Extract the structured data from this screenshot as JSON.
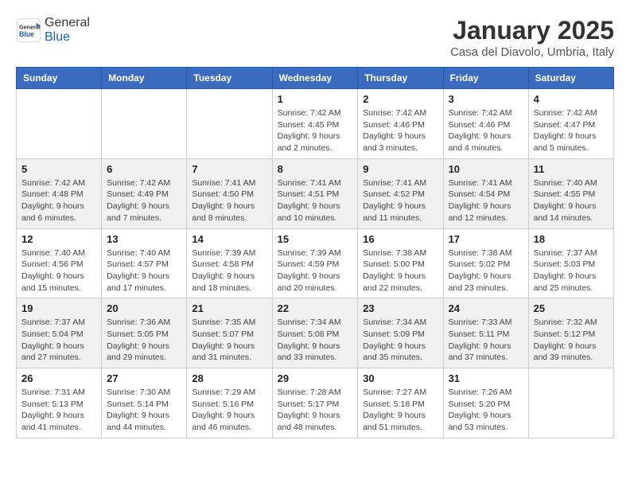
{
  "header": {
    "logo_general": "General",
    "logo_blue": "Blue",
    "title": "January 2025",
    "subtitle": "Casa del Diavolo, Umbria, Italy"
  },
  "weekdays": [
    "Sunday",
    "Monday",
    "Tuesday",
    "Wednesday",
    "Thursday",
    "Friday",
    "Saturday"
  ],
  "weeks": [
    [
      {
        "day": "",
        "info": ""
      },
      {
        "day": "",
        "info": ""
      },
      {
        "day": "",
        "info": ""
      },
      {
        "day": "1",
        "info": "Sunrise: 7:42 AM\nSunset: 4:45 PM\nDaylight: 9 hours and 2 minutes."
      },
      {
        "day": "2",
        "info": "Sunrise: 7:42 AM\nSunset: 4:46 PM\nDaylight: 9 hours and 3 minutes."
      },
      {
        "day": "3",
        "info": "Sunrise: 7:42 AM\nSunset: 4:46 PM\nDaylight: 9 hours and 4 minutes."
      },
      {
        "day": "4",
        "info": "Sunrise: 7:42 AM\nSunset: 4:47 PM\nDaylight: 9 hours and 5 minutes."
      }
    ],
    [
      {
        "day": "5",
        "info": "Sunrise: 7:42 AM\nSunset: 4:48 PM\nDaylight: 9 hours and 6 minutes."
      },
      {
        "day": "6",
        "info": "Sunrise: 7:42 AM\nSunset: 4:49 PM\nDaylight: 9 hours and 7 minutes."
      },
      {
        "day": "7",
        "info": "Sunrise: 7:41 AM\nSunset: 4:50 PM\nDaylight: 9 hours and 8 minutes."
      },
      {
        "day": "8",
        "info": "Sunrise: 7:41 AM\nSunset: 4:51 PM\nDaylight: 9 hours and 10 minutes."
      },
      {
        "day": "9",
        "info": "Sunrise: 7:41 AM\nSunset: 4:52 PM\nDaylight: 9 hours and 11 minutes."
      },
      {
        "day": "10",
        "info": "Sunrise: 7:41 AM\nSunset: 4:54 PM\nDaylight: 9 hours and 12 minutes."
      },
      {
        "day": "11",
        "info": "Sunrise: 7:40 AM\nSunset: 4:55 PM\nDaylight: 9 hours and 14 minutes."
      }
    ],
    [
      {
        "day": "12",
        "info": "Sunrise: 7:40 AM\nSunset: 4:56 PM\nDaylight: 9 hours and 15 minutes."
      },
      {
        "day": "13",
        "info": "Sunrise: 7:40 AM\nSunset: 4:57 PM\nDaylight: 9 hours and 17 minutes."
      },
      {
        "day": "14",
        "info": "Sunrise: 7:39 AM\nSunset: 4:58 PM\nDaylight: 9 hours and 18 minutes."
      },
      {
        "day": "15",
        "info": "Sunrise: 7:39 AM\nSunset: 4:59 PM\nDaylight: 9 hours and 20 minutes."
      },
      {
        "day": "16",
        "info": "Sunrise: 7:38 AM\nSunset: 5:00 PM\nDaylight: 9 hours and 22 minutes."
      },
      {
        "day": "17",
        "info": "Sunrise: 7:38 AM\nSunset: 5:02 PM\nDaylight: 9 hours and 23 minutes."
      },
      {
        "day": "18",
        "info": "Sunrise: 7:37 AM\nSunset: 5:03 PM\nDaylight: 9 hours and 25 minutes."
      }
    ],
    [
      {
        "day": "19",
        "info": "Sunrise: 7:37 AM\nSunset: 5:04 PM\nDaylight: 9 hours and 27 minutes."
      },
      {
        "day": "20",
        "info": "Sunrise: 7:36 AM\nSunset: 5:05 PM\nDaylight: 9 hours and 29 minutes."
      },
      {
        "day": "21",
        "info": "Sunrise: 7:35 AM\nSunset: 5:07 PM\nDaylight: 9 hours and 31 minutes."
      },
      {
        "day": "22",
        "info": "Sunrise: 7:34 AM\nSunset: 5:08 PM\nDaylight: 9 hours and 33 minutes."
      },
      {
        "day": "23",
        "info": "Sunrise: 7:34 AM\nSunset: 5:09 PM\nDaylight: 9 hours and 35 minutes."
      },
      {
        "day": "24",
        "info": "Sunrise: 7:33 AM\nSunset: 5:11 PM\nDaylight: 9 hours and 37 minutes."
      },
      {
        "day": "25",
        "info": "Sunrise: 7:32 AM\nSunset: 5:12 PM\nDaylight: 9 hours and 39 minutes."
      }
    ],
    [
      {
        "day": "26",
        "info": "Sunrise: 7:31 AM\nSunset: 5:13 PM\nDaylight: 9 hours and 41 minutes."
      },
      {
        "day": "27",
        "info": "Sunrise: 7:30 AM\nSunset: 5:14 PM\nDaylight: 9 hours and 44 minutes."
      },
      {
        "day": "28",
        "info": "Sunrise: 7:29 AM\nSunset: 5:16 PM\nDaylight: 9 hours and 46 minutes."
      },
      {
        "day": "29",
        "info": "Sunrise: 7:28 AM\nSunset: 5:17 PM\nDaylight: 9 hours and 48 minutes."
      },
      {
        "day": "30",
        "info": "Sunrise: 7:27 AM\nSunset: 5:18 PM\nDaylight: 9 hours and 51 minutes."
      },
      {
        "day": "31",
        "info": "Sunrise: 7:26 AM\nSunset: 5:20 PM\nDaylight: 9 hours and 53 minutes."
      },
      {
        "day": "",
        "info": ""
      }
    ]
  ]
}
